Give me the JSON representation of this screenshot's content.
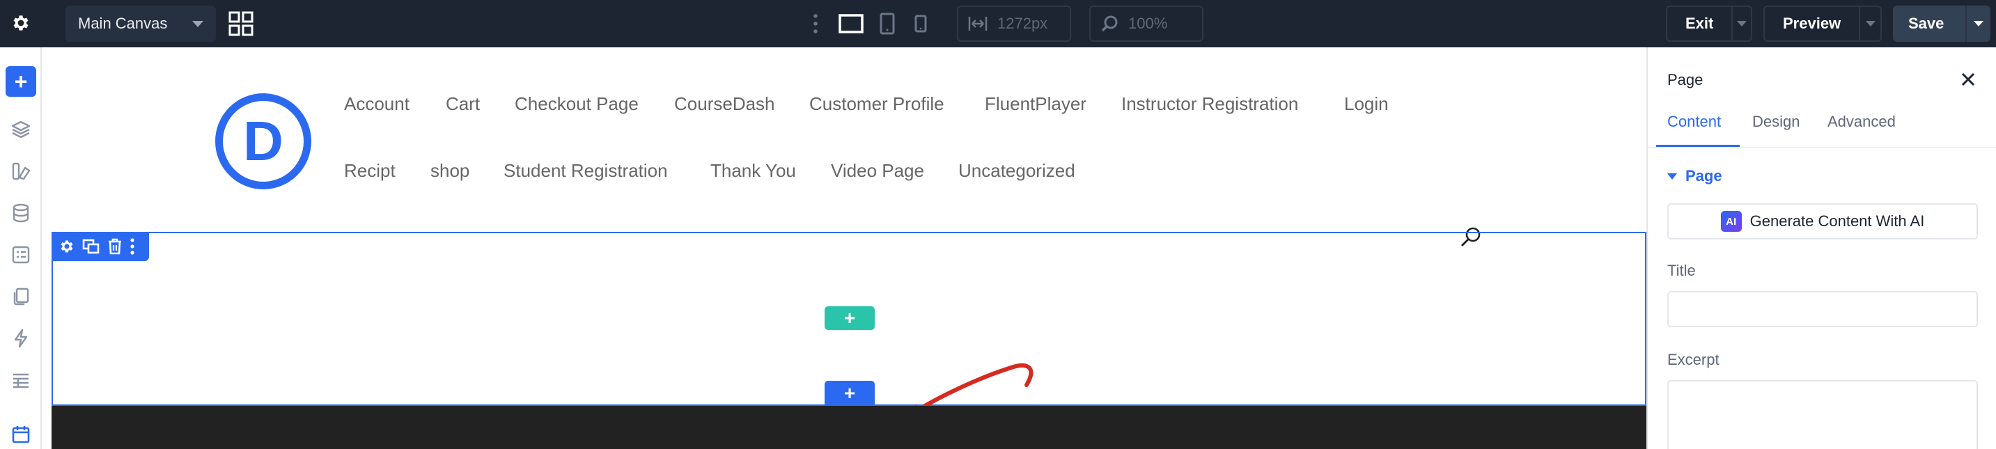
{
  "topbar": {
    "canvas_select_value": "Main Canvas",
    "width_value": "1272px",
    "zoom_value": "100%",
    "exit_label": "Exit",
    "preview_label": "Preview",
    "save_label": "Save"
  },
  "site": {
    "logo_letter": "D",
    "menu_row1": [
      "Account",
      "Cart",
      "Checkout Page",
      "CourseDash",
      "Customer Profile",
      "FluentPlayer",
      "Instructor Registration",
      "Login"
    ],
    "menu_row2": [
      "Recipt",
      "shop",
      "Student Registration",
      "Thank You",
      "Video Page",
      "Uncategorized"
    ]
  },
  "builder": {
    "add_row_symbol": "+",
    "add_section_symbol": "+",
    "rail_add_symbol": "+"
  },
  "panel": {
    "title": "Page",
    "tabs": [
      "Content",
      "Design",
      "Advanced"
    ],
    "active_tab": "Content",
    "group_title": "Page",
    "ai_badge": "AI",
    "generate_label": "Generate Content With AI",
    "title_label": "Title",
    "title_value": "",
    "excerpt_label": "Excerpt",
    "excerpt_value": ""
  },
  "colors": {
    "accent": "#2b6af0",
    "green": "#29c4a9",
    "topbar": "#1d2532",
    "annotation_arrow": "#d62a20"
  }
}
